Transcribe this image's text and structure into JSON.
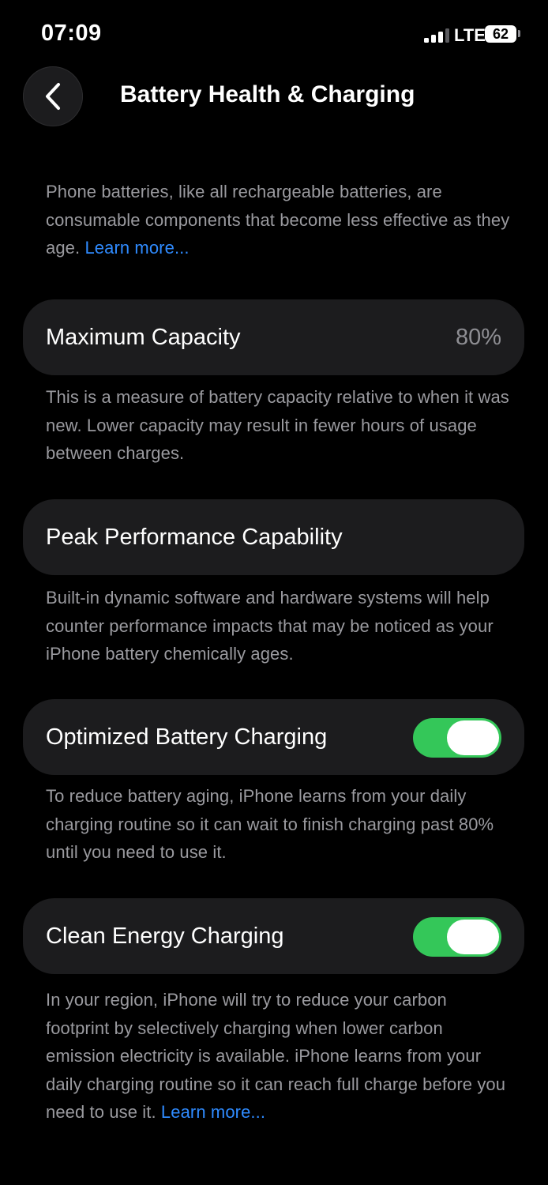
{
  "status_bar": {
    "time": "07:09",
    "network": "LTE",
    "battery_level": "62",
    "signal_bars_active": 3,
    "signal_bars_total": 4
  },
  "nav": {
    "title": "Battery Health & Charging",
    "back_icon": "chevron-left-icon"
  },
  "intro": {
    "text": "Phone batteries, like all rechargeable batteries, are consumable components that become less effective as they age. ",
    "link": "Learn more..."
  },
  "maximum_capacity": {
    "label": "Maximum Capacity",
    "value": "80%",
    "description": "This is a measure of battery capacity relative to when it was new. Lower capacity may result in fewer hours of usage between charges."
  },
  "peak_performance": {
    "label": "Peak Performance Capability",
    "description": "Built-in dynamic software and hardware systems will help counter performance impacts that may be noticed as your iPhone battery chemically ages."
  },
  "optimized_charging": {
    "label": "Optimized Battery Charging",
    "enabled": true,
    "description": "To reduce battery aging, iPhone learns from your daily charging routine so it can wait to finish charging past 80% until you need to use it."
  },
  "clean_energy": {
    "label": "Clean Energy Charging",
    "enabled": true,
    "description": "In your region, iPhone will try to reduce your carbon footprint by selectively charging when lower carbon emission electricity is available. iPhone learns from your daily charging routine so it can reach full charge before you need to use it. ",
    "link": "Learn more..."
  },
  "colors": {
    "background": "#000000",
    "card": "#1c1c1e",
    "toggle_on": "#34c759",
    "link": "#2f8bff",
    "secondary_text": "#9a9a9f"
  }
}
